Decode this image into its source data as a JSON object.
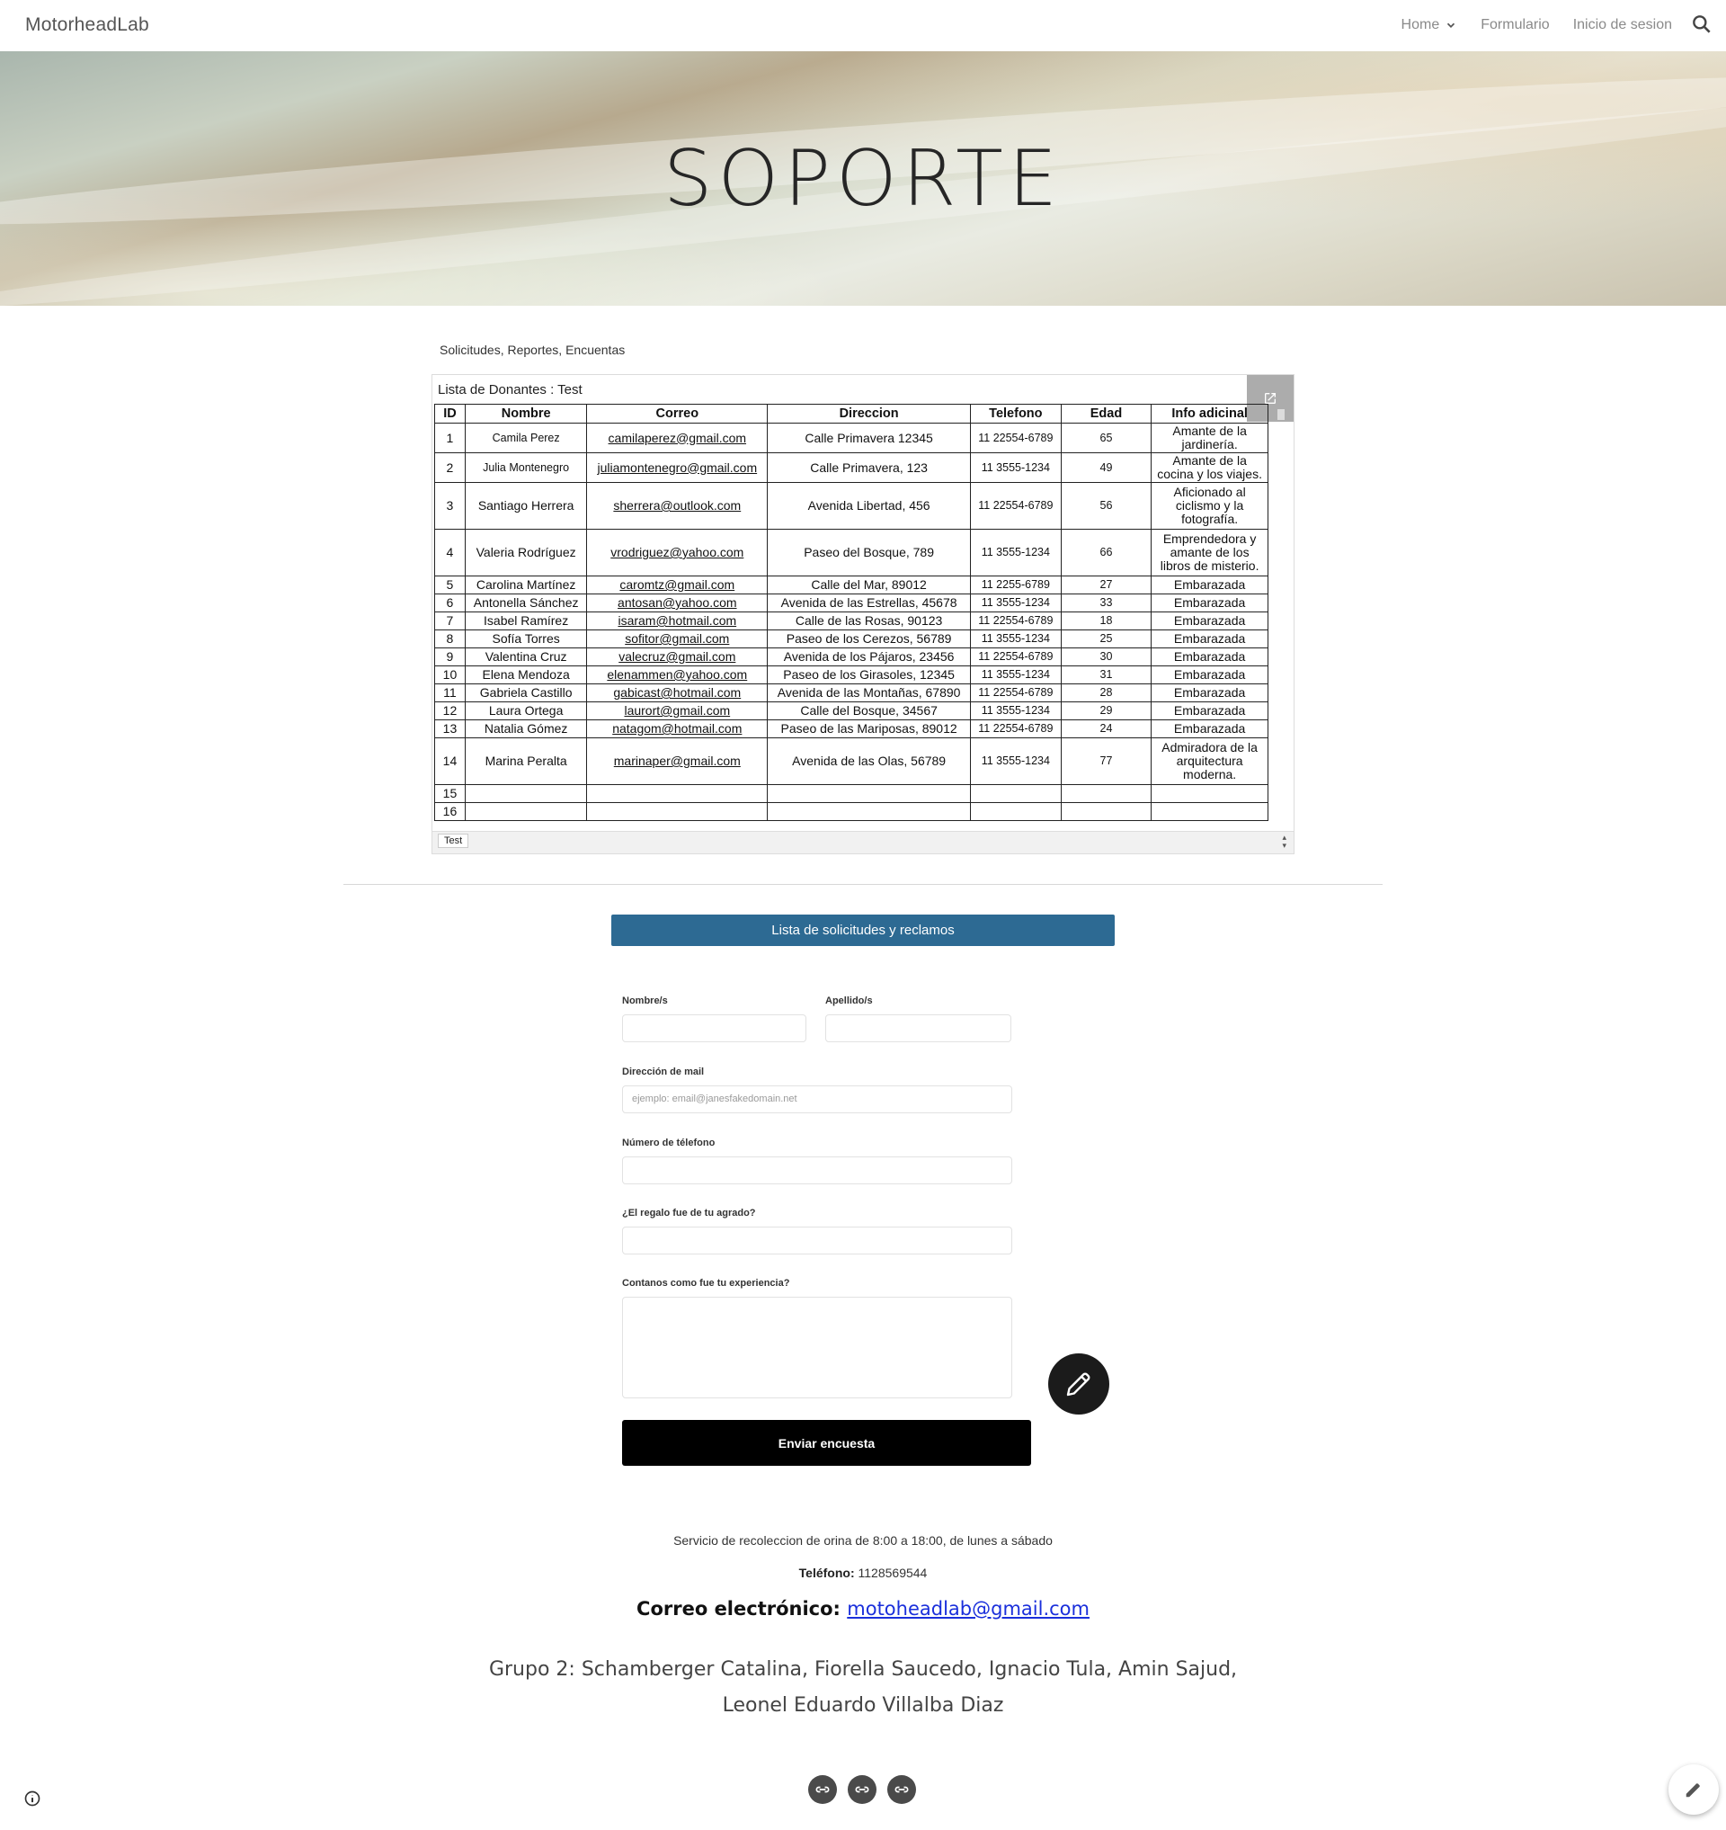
{
  "site": {
    "title": "MotorheadLab"
  },
  "nav": {
    "home": "Home",
    "form": "Formulario",
    "login": "Inicio de sesion"
  },
  "hero": {
    "title": "SOPORTE"
  },
  "section": {
    "label": "Solicitudes, Reportes, Encuentas"
  },
  "sheet": {
    "title": "Lista de Donantes : Test",
    "tab": "Test",
    "headers": [
      "ID",
      "Nombre",
      "Correo",
      "Direccion",
      "Telefono",
      "Edad",
      "Info adicinal"
    ],
    "rows": [
      [
        "1",
        "Camila Perez",
        "camilaperez@gmail.com",
        "Calle Primavera 12345",
        "11 22554-6789",
        "65",
        "Amante de la jardinería."
      ],
      [
        "2",
        "Julia Montenegro",
        "juliamontenegro@gmail.com",
        "Calle Primavera, 123",
        "11 3555-1234",
        "49",
        "Amante de la cocina y los viajes."
      ],
      [
        "3",
        "Santiago Herrera",
        "sherrera@outlook.com",
        "Avenida Libertad, 456",
        "11 22554-6789",
        "56",
        "Aficionado al ciclismo y la fotografía."
      ],
      [
        "4",
        "Valeria Rodríguez",
        "vrodriguez@yahoo.com",
        "Paseo del Bosque, 789",
        "11 3555-1234",
        "66",
        "Emprendedora y amante de los libros de misterio."
      ],
      [
        "5",
        "Carolina Martínez",
        "caromtz@gmail.com",
        "Calle del Mar, 89012",
        "11 2255-6789",
        "27",
        "Embarazada"
      ],
      [
        "6",
        "Antonella Sánchez",
        "antosan@yahoo.com",
        "Avenida de las Estrellas, 45678",
        "11 3555-1234",
        "33",
        "Embarazada"
      ],
      [
        "7",
        "Isabel Ramírez",
        "isaram@hotmail.com",
        "Calle de las Rosas, 90123",
        "11 22554-6789",
        "18",
        "Embarazada"
      ],
      [
        "8",
        "Sofía Torres",
        "sofitor@gmail.com",
        "Paseo de los Cerezos, 56789",
        "11 3555-1234",
        "25",
        "Embarazada"
      ],
      [
        "9",
        "Valentina Cruz",
        "valecruz@gmail.com",
        "Avenida de los Pájaros, 23456",
        "11 22554-6789",
        "30",
        "Embarazada"
      ],
      [
        "10",
        "Elena Mendoza",
        "elenammen@yahoo.com",
        "Paseo de los Girasoles, 12345",
        "11 3555-1234",
        "31",
        "Embarazada"
      ],
      [
        "11",
        "Gabriela Castillo",
        "gabicast@hotmail.com",
        "Avenida de las Montañas, 67890",
        "11 22554-6789",
        "28",
        "Embarazada"
      ],
      [
        "12",
        "Laura Ortega",
        "laurort@gmail.com",
        "Calle del Bosque, 34567",
        "11 3555-1234",
        "29",
        "Embarazada"
      ],
      [
        "13",
        "Natalia Gómez",
        "natagom@hotmail.com",
        "Paseo de las Mariposas, 89012",
        "11 22554-6789",
        "24",
        "Embarazada"
      ],
      [
        "14",
        "Marina Peralta",
        "marinaper@gmail.com",
        "Avenida de las Olas, 56789",
        "11 3555-1234",
        "77",
        "Admiradora de la arquitectura moderna."
      ],
      [
        "15",
        "",
        "",
        "",
        "",
        "",
        ""
      ],
      [
        "16",
        "",
        "",
        "",
        "",
        "",
        ""
      ]
    ]
  },
  "survey": {
    "header_button": "Lista de solicitudes y reclamos",
    "labels": {
      "first_name": "Nombre/s",
      "last_name": "Apellido/s",
      "email": "Dirección de mail",
      "phone": "Número de télefono",
      "gift": "¿El regalo fue de tu agrado?",
      "experience": "Contanos como fue tu experiencia?"
    },
    "placeholders": {
      "email": "ejemplo: email@janesfakedomain.net"
    },
    "submit": "Enviar encuesta"
  },
  "footer": {
    "hours": "Servicio de recoleccion de orina de 8:00 a 18:00, de lunes a sábado",
    "phone_label": "Teléfono:",
    "phone_value": " 1128569544",
    "email_label": "Correo electrónico:",
    "email_value": "motoheadlab@gmail.com",
    "group_line1": "Grupo 2:  Schamberger Catalina, Fiorella Saucedo, Ignacio Tula, Amin Sajud,",
    "group_line2": "Leonel Eduardo Villalba Diaz"
  },
  "icons": {
    "search": "search-icon",
    "chevron": "chevron-down-icon",
    "open": "open-in-new-icon",
    "edit": "pencil-icon",
    "link": "link-icon",
    "info": "info-icon"
  }
}
